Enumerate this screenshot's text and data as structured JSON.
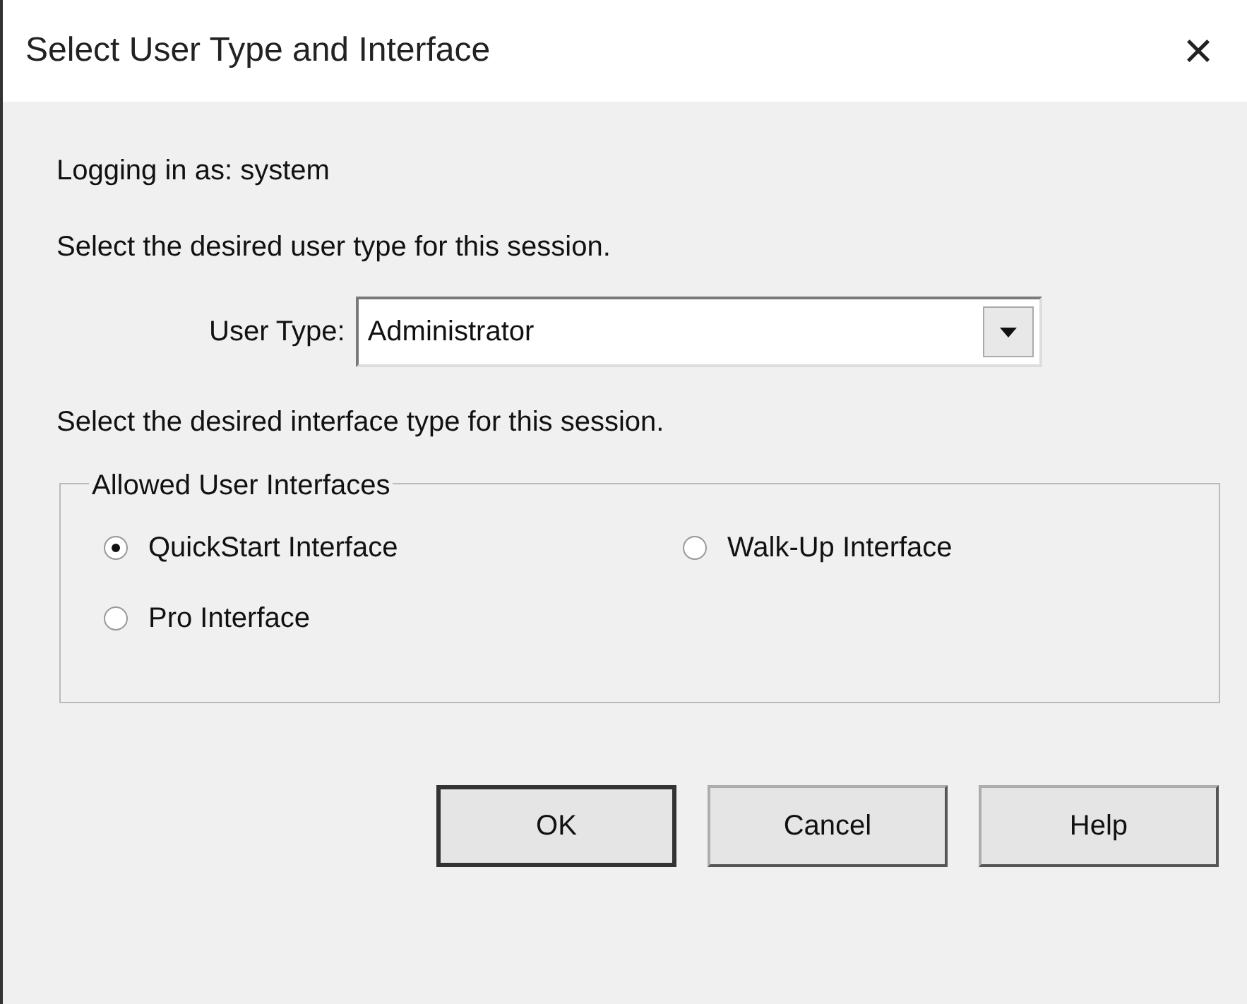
{
  "window": {
    "title": "Select User Type and Interface",
    "close": "×"
  },
  "login_text": "Logging in as: system",
  "user_type_prompt": "Select the desired user type for this session.",
  "user_type": {
    "label": "User Type:",
    "value": "Administrator"
  },
  "interface_prompt": "Select the desired interface type for this session.",
  "interfaces": {
    "title": "Allowed User Interfaces",
    "options": [
      {
        "label": "QuickStart Interface",
        "selected": true
      },
      {
        "label": "Walk-Up Interface",
        "selected": false
      },
      {
        "label": "Pro Interface",
        "selected": false
      }
    ]
  },
  "buttons": [
    {
      "label": "OK",
      "default": true
    },
    {
      "label": "Cancel",
      "default": false
    },
    {
      "label": "Help",
      "default": false
    }
  ]
}
